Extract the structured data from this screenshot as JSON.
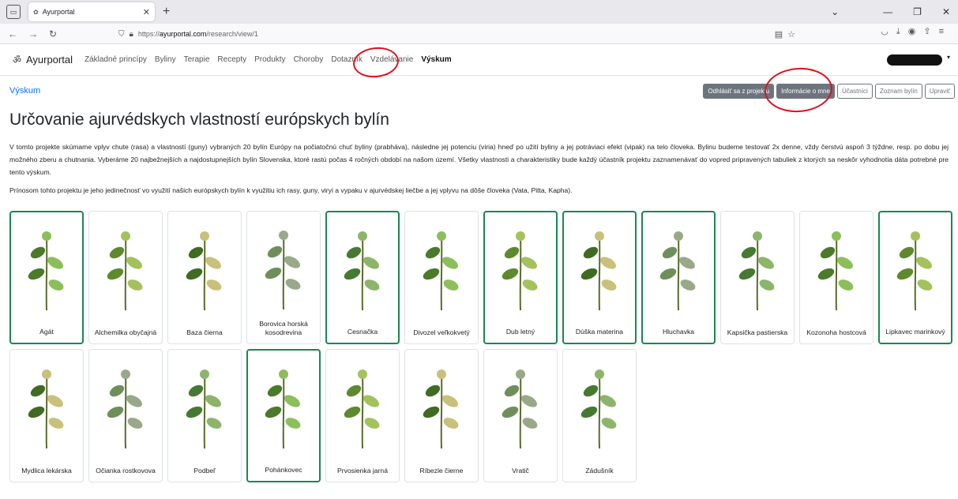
{
  "browser": {
    "tab_title": "Ayurportal",
    "url_prefix": "https://",
    "url_host": "ayurportal.com",
    "url_path": "/research/view/1"
  },
  "site": {
    "brand": "Ayurportal",
    "nav": [
      {
        "label": "Základné princípy"
      },
      {
        "label": "Byliny"
      },
      {
        "label": "Terapie"
      },
      {
        "label": "Recepty"
      },
      {
        "label": "Produkty"
      },
      {
        "label": "Choroby"
      },
      {
        "label": "Dotazník"
      },
      {
        "label": "Vzdelávanie"
      },
      {
        "label": "Výskum",
        "active": true
      }
    ]
  },
  "page": {
    "breadcrumb": "Výskum",
    "actions": [
      "Odhlásiť sa z projektu",
      "Informácie o mne",
      "Účastníci",
      "Zoznam bylín",
      "Upraviť"
    ],
    "title": "Určovanie ajurvédskych vlastností európskych bylín",
    "paragraph1": "V tomto projekte skúmame vplyv chute (rasa) a vlastností (guny) vybraných 20 bylín Európy na počiatočnú chuť byliny (prabháva), následne jej potenciu (viria) hneď po užití byliny a jej potráviaci efekt (vipak) na telo človeka. Bylinu budeme testovať 2x denne, vždy čerstvú aspoň 3 týždne, resp. po dobu jej možného zberu a chutnania. Vyberáme 20 najbežnejších a najdostupnejších bylín Slovenska, ktoré rastú počas 4 ročných období na našom území. Všetky vlastnosti a charakteristiky bude každý účastník projektu zaznamenávať do vopred pripravených tabuliek z ktorých sa neskôr vyhodnotia dáta potrebné pre tento výskum.",
    "paragraph2": "Prínosom tohto projektu je jeho jedinečnosť vo využití našich európskych bylín k využitiu ich rasy, guny, viryi a vypaku v ajurvédskej liečbe a jej vplyvu na dôše človeka (Vata, Pitta, Kapha)."
  },
  "herbs": [
    {
      "name": "Agát",
      "selected": true
    },
    {
      "name": "Alchemilka obyčajná",
      "selected": false
    },
    {
      "name": "Baza čierna",
      "selected": false
    },
    {
      "name": "Borovica horská kosodrevina",
      "selected": false
    },
    {
      "name": "Cesnačka",
      "selected": true
    },
    {
      "name": "Divozel veľkokvetý",
      "selected": false
    },
    {
      "name": "Dub letný",
      "selected": true
    },
    {
      "name": "Dúška materina",
      "selected": true
    },
    {
      "name": "Hluchavka",
      "selected": true
    },
    {
      "name": "Kapsička pastierska",
      "selected": false
    },
    {
      "name": "Kozonoha hostcová",
      "selected": false
    },
    {
      "name": "Lipkavec marinkový",
      "selected": true
    },
    {
      "name": "Mydlica lekárska",
      "selected": false
    },
    {
      "name": "Očianka rostkovova",
      "selected": false
    },
    {
      "name": "Podbeľ",
      "selected": false
    },
    {
      "name": "Pohánkovec",
      "selected": true
    },
    {
      "name": "Prvosienka jarná",
      "selected": false
    },
    {
      "name": "Ríbezle čierne",
      "selected": false
    },
    {
      "name": "Vratič",
      "selected": false
    },
    {
      "name": "Zádušník",
      "selected": false
    }
  ],
  "colors": {
    "selected_border": "#198754",
    "link": "#0d6efd",
    "annotation": "#e0101c"
  }
}
